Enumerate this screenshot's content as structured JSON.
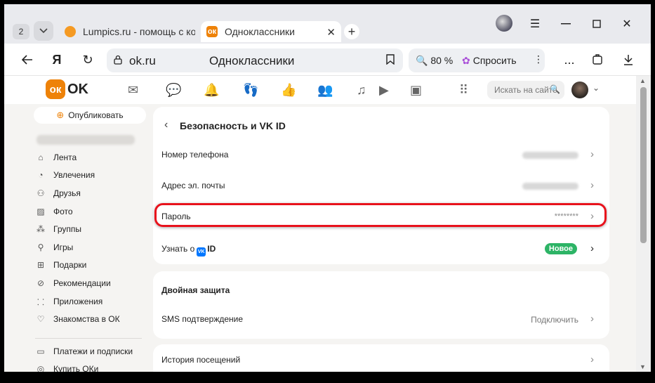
{
  "browser": {
    "tab_count": "2",
    "tabs": [
      {
        "title": "Lumpics.ru - помощь с ком"
      },
      {
        "title": "Одноклассники"
      }
    ],
    "address": {
      "host": "ok.ru",
      "page_title": "Одноклассники"
    },
    "zoom": "80 %",
    "ask_label": "Спросить",
    "menu_more": "...",
    "accent_color": "#ee8208"
  },
  "site": {
    "logo_text": "OK",
    "search_placeholder": "Искать на сайте"
  },
  "sidebar": {
    "publish_label": "Опубликовать",
    "items": [
      {
        "label": "Лента",
        "icon": "home-icon"
      },
      {
        "label": "Увлечения",
        "icon": "interests-icon"
      },
      {
        "label": "Друзья",
        "icon": "friends-icon"
      },
      {
        "label": "Фото",
        "icon": "photo-icon"
      },
      {
        "label": "Группы",
        "icon": "groups-icon"
      },
      {
        "label": "Игры",
        "icon": "games-icon"
      },
      {
        "label": "Подарки",
        "icon": "gift-icon"
      },
      {
        "label": "Рекомендации",
        "icon": "recommendations-icon"
      },
      {
        "label": "Приложения",
        "icon": "apps-icon"
      },
      {
        "label": "Знакомства в ОК",
        "icon": "dating-icon"
      }
    ],
    "items2": [
      {
        "label": "Платежи и подписки",
        "icon": "payments-icon"
      },
      {
        "label": "Купить ОКи",
        "icon": "coins-icon"
      }
    ]
  },
  "security": {
    "title": "Безопасность и VK ID",
    "rows": [
      {
        "label": "Номер телефона"
      },
      {
        "label": "Адрес эл. почты"
      },
      {
        "label": "Пароль",
        "value": "********"
      }
    ],
    "vkid": {
      "prefix": "Узнать о",
      "badge": "VK",
      "suffix": "ID",
      "new_label": "Новое",
      "new_color": "#2db466"
    },
    "highlight_color": "#e8121c"
  },
  "twofactor": {
    "title": "Двойная защита",
    "sms_label": "SMS подтверждение",
    "sms_action": "Подключить"
  },
  "history": {
    "label": "История посещений"
  }
}
